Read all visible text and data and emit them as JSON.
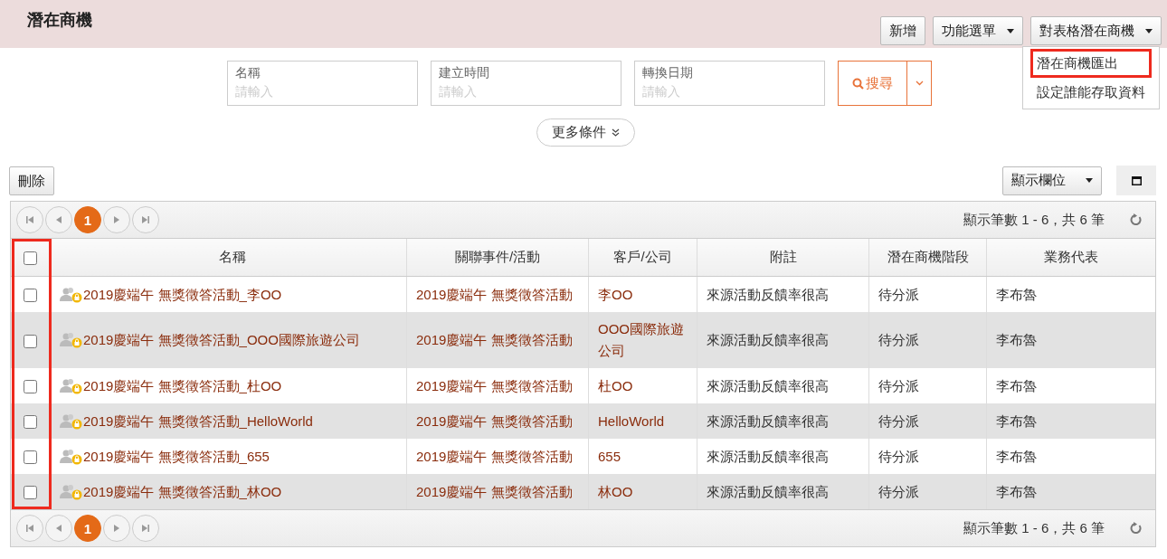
{
  "header": {
    "title": "潛在商機",
    "buttons": [
      {
        "label": "新增",
        "has_caret": false
      },
      {
        "label": "功能選單",
        "has_caret": true
      },
      {
        "label": "對表格潛在商機",
        "has_caret": true
      }
    ],
    "menu": {
      "items": [
        {
          "label": "潛在商機匯出",
          "highlighted": true
        },
        {
          "label": "設定誰能存取資料",
          "highlighted": false
        }
      ]
    }
  },
  "search": {
    "fields": [
      {
        "label": "名稱",
        "placeholder": "請輸入"
      },
      {
        "label": "建立時間",
        "placeholder": "請輸入"
      },
      {
        "label": "轉換日期",
        "placeholder": "請輸入"
      }
    ],
    "button": "搜尋",
    "more": "更多條件"
  },
  "toolbar": {
    "delete": "刪除",
    "columns_button": "顯示欄位"
  },
  "pager_top": {
    "pages": [
      {
        "label": "1",
        "selected": true
      }
    ],
    "summary": "顯示筆數 1 - 6，共 6 筆"
  },
  "table": {
    "checkbox_column_highlighted": true,
    "header_checked": false,
    "columns": [
      "名稱",
      "關聯事件/活動",
      "客戶/公司",
      "附註",
      "潛在商機階段",
      "業務代表"
    ],
    "rows": [
      {
        "checked": false,
        "cells": [
          "2019慶端午 無獎徵答活動_李OO",
          "2019慶端午 無獎徵答活動",
          "李OO",
          "來源活動反饋率很高",
          "待分派",
          "李布魯"
        ]
      },
      {
        "checked": false,
        "cells": [
          "2019慶端午 無獎徵答活動_OOO國際旅遊公司",
          "2019慶端午 無獎徵答活動",
          "OOO國際旅遊公司",
          "來源活動反饋率很高",
          "待分派",
          "李布魯"
        ]
      },
      {
        "checked": false,
        "cells": [
          "2019慶端午 無獎徵答活動_杜OO",
          "2019慶端午 無獎徵答活動",
          "杜OO",
          "來源活動反饋率很高",
          "待分派",
          "李布魯"
        ]
      },
      {
        "checked": false,
        "cells": [
          "2019慶端午 無獎徵答活動_HelloWorld",
          "2019慶端午 無獎徵答活動",
          "HelloWorld",
          "來源活動反饋率很高",
          "待分派",
          "李布魯"
        ]
      },
      {
        "checked": false,
        "cells": [
          "2019慶端午 無獎徵答活動_655",
          "2019慶端午 無獎徵答活動",
          "655",
          "來源活動反饋率很高",
          "待分派",
          "李布魯"
        ]
      },
      {
        "checked": false,
        "cells": [
          "2019慶端午 無獎徵答活動_林OO",
          "2019慶端午 無獎徵答活動",
          "林OO",
          "來源活動反饋率很高",
          "待分派",
          "李布魯"
        ]
      }
    ]
  },
  "pager_bottom": {
    "pages": [
      {
        "label": "1",
        "selected": true
      }
    ],
    "summary": "顯示筆數 1 - 6，共 6 筆"
  }
}
